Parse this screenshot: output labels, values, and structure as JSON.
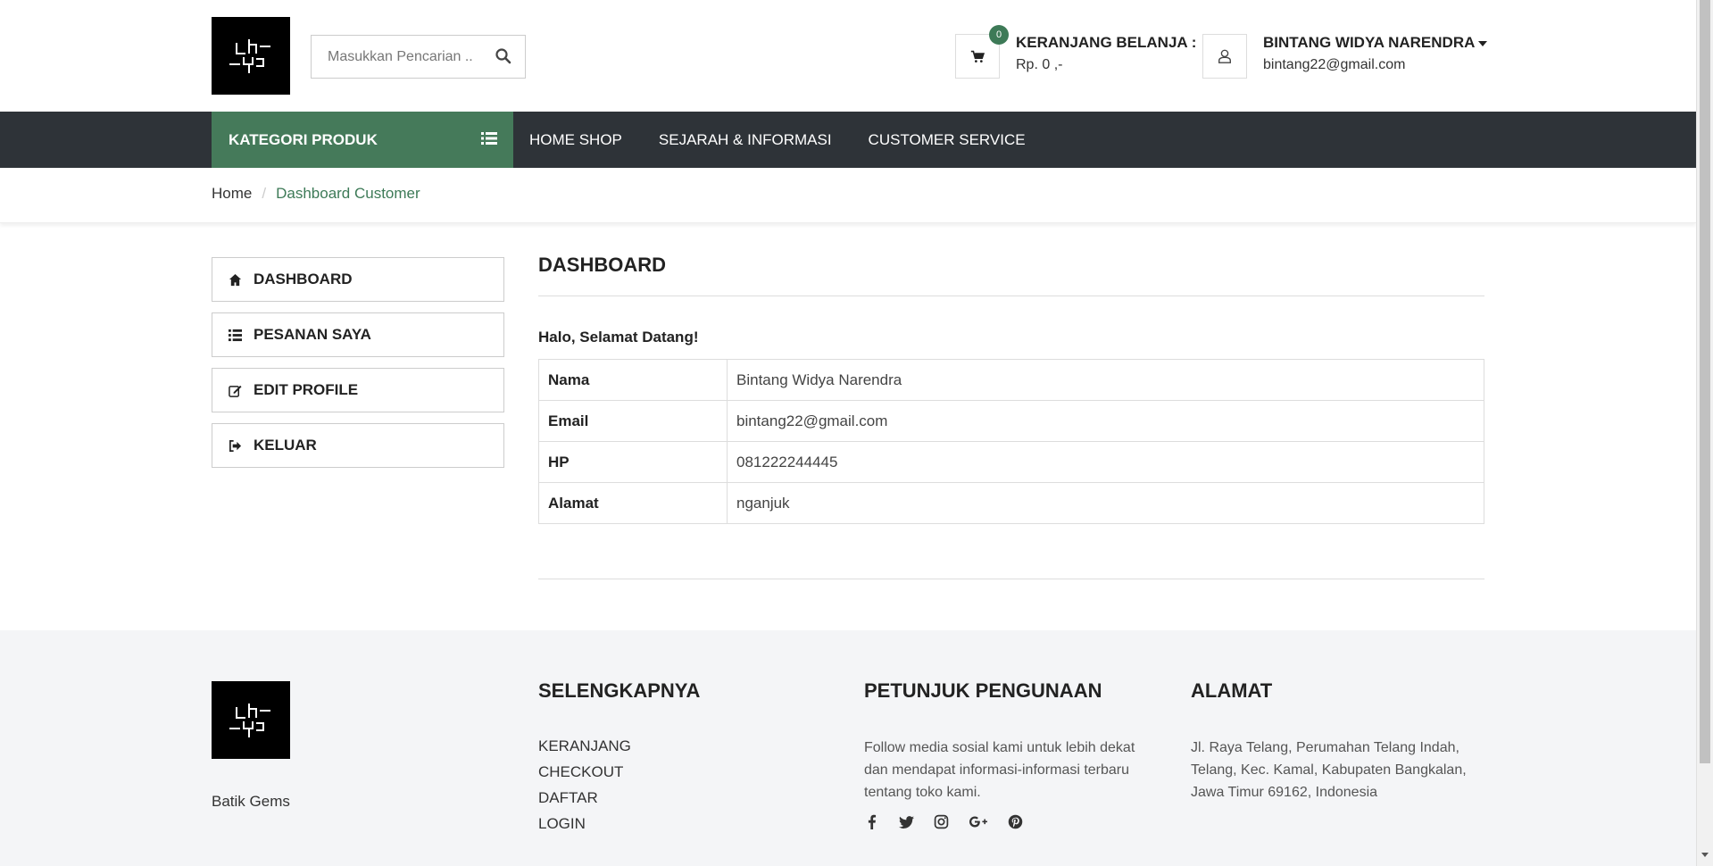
{
  "header": {
    "search_placeholder": "Masukkan Pencarian ..",
    "cart": {
      "count": "0",
      "title": "KERANJANG BELANJA :",
      "total": "Rp. 0 ,-"
    },
    "user": {
      "name": "BINTANG WIDYA NARENDRA",
      "email": "bintang22@gmail.com"
    }
  },
  "nav": {
    "category_label": "KATEGORI PRODUK",
    "links": [
      "HOME SHOP",
      "SEJARAH & INFORMASI",
      "CUSTOMER SERVICE"
    ]
  },
  "breadcrumb": {
    "home": "Home",
    "current": "Dashboard Customer"
  },
  "sidebar": {
    "items": [
      {
        "label": "DASHBOARD",
        "icon": "home-icon"
      },
      {
        "label": "PESANAN SAYA",
        "icon": "list-icon"
      },
      {
        "label": "EDIT PROFILE",
        "icon": "edit-icon"
      },
      {
        "label": "KELUAR",
        "icon": "sign-out-icon"
      }
    ]
  },
  "main": {
    "title": "DASHBOARD",
    "greeting": "Halo, Selamat Datang!",
    "rows": [
      {
        "key": "Nama",
        "value": "Bintang Widya Narendra"
      },
      {
        "key": "Email",
        "value": "bintang22@gmail.com"
      },
      {
        "key": "HP",
        "value": "081222244445"
      },
      {
        "key": "Alamat",
        "value": "nganjuk"
      }
    ]
  },
  "footer": {
    "brand": "Batik Gems",
    "col1_title": "SELENGKAPNYA",
    "col1_links": [
      "KERANJANG",
      "CHECKOUT",
      "DAFTAR",
      "LOGIN"
    ],
    "col2_title": "PETUNJUK PENGUNAAN",
    "col2_text": "Follow media sosial kami untuk lebih dekat dan mendapat informasi-informasi terbaru tentang toko kami.",
    "social_icons": [
      "facebook-icon",
      "twitter-icon",
      "instagram-icon",
      "google-plus-icon",
      "pinterest-icon"
    ],
    "col3_title": "ALAMAT",
    "col3_text": "Jl. Raya Telang, Perumahan Telang Indah, Telang, Kec. Kamal, Kabupaten Bangkalan, Jawa Timur 69162, Indonesia"
  },
  "colors": {
    "accent": "#457a5a",
    "navbar": "#2e3338",
    "footer_bg": "#f4f5f7"
  }
}
